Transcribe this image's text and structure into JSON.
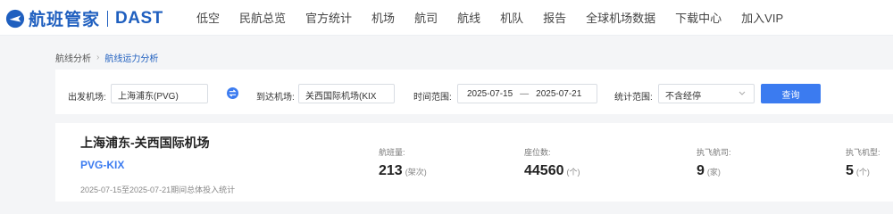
{
  "header": {
    "logo_cn": "航班管家",
    "logo_en": "DAST",
    "nav": [
      "低空",
      "民航总览",
      "官方统计",
      "机场",
      "航司",
      "航线",
      "机队",
      "报告",
      "全球机场数据",
      "下载中心",
      "加入VIP"
    ]
  },
  "breadcrumb": {
    "parent": "航线分析",
    "current": "航线运力分析"
  },
  "filters": {
    "origin_label": "出发机场:",
    "origin_value": "上海浦东(PVG)",
    "dest_label": "到达机场:",
    "dest_value": "关西国际机场(KIX",
    "time_label": "时间范围:",
    "date_start": "2025-07-15",
    "date_sep": "—",
    "date_end": "2025-07-21",
    "stat_label": "统计范围:",
    "stat_value": "不含经停",
    "query_label": "查询"
  },
  "summary": {
    "title": "上海浦东-关西国际机场",
    "code": "PVG-KIX",
    "note": "2025-07-15至2025-07-21期间总体投入统计",
    "stats": [
      {
        "label": "航班量:",
        "value": "213",
        "unit": "(架次)"
      },
      {
        "label": "座位数:",
        "value": "44560",
        "unit": "(个)"
      },
      {
        "label": "执飞航司:",
        "value": "9",
        "unit": "(家)"
      },
      {
        "label": "执飞机型:",
        "value": "5",
        "unit": "(个)"
      }
    ]
  },
  "colors": {
    "brand": "#1f5fbf",
    "accent": "#3b7bf0"
  }
}
